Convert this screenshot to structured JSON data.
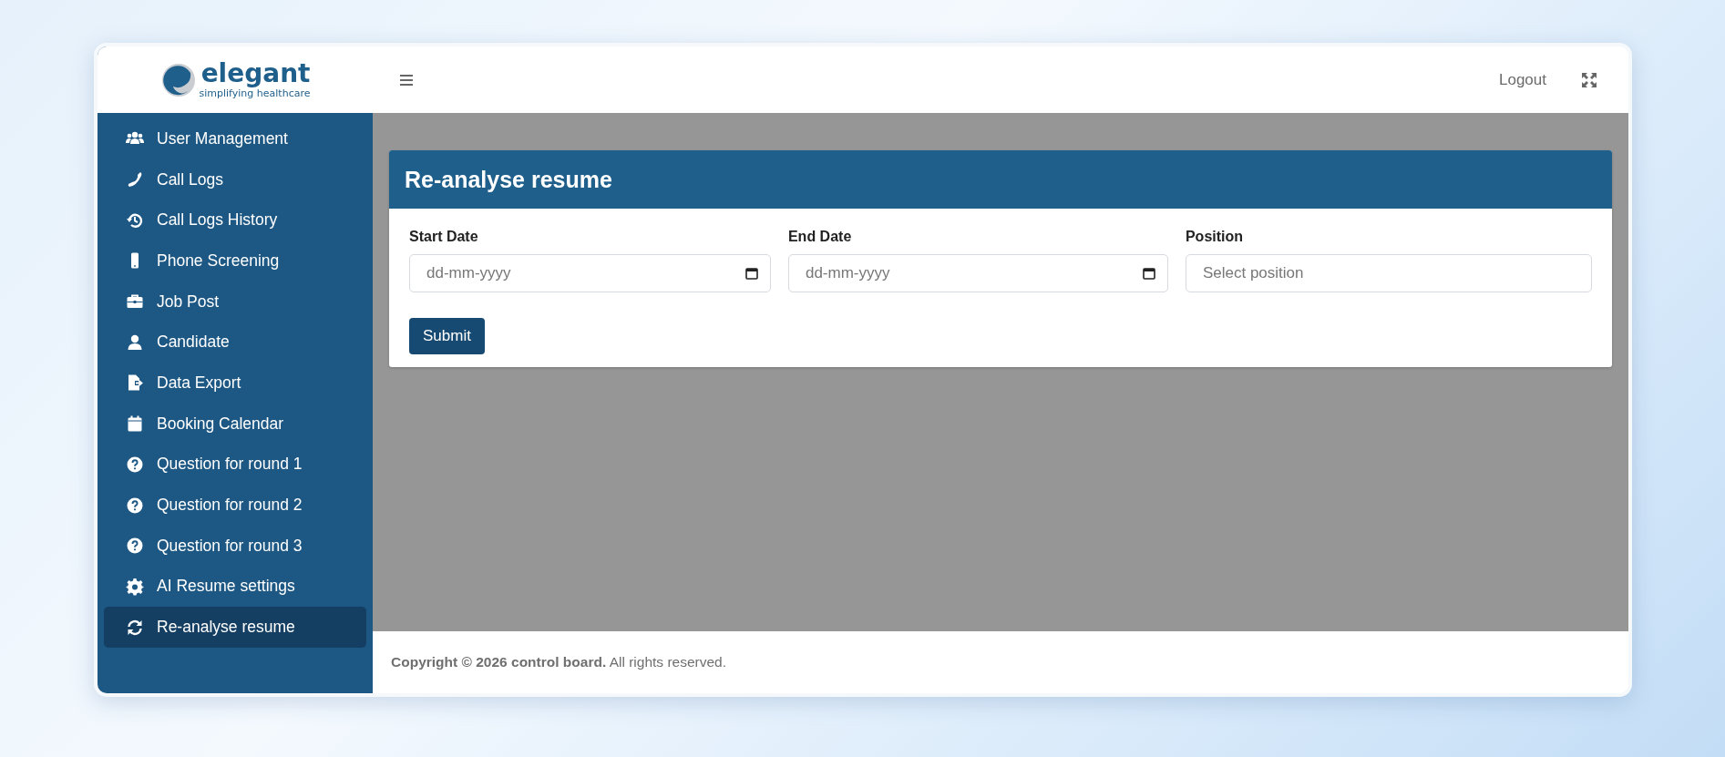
{
  "logo": {
    "name": "elegant",
    "tagline": "simplifying healthcare"
  },
  "sidebar": {
    "items": [
      {
        "label": "User Management",
        "selected": false
      },
      {
        "label": "Call Logs",
        "selected": false
      },
      {
        "label": "Call Logs History",
        "selected": false
      },
      {
        "label": "Phone Screening",
        "selected": false
      },
      {
        "label": "Job Post",
        "selected": false
      },
      {
        "label": "Candidate",
        "selected": false
      },
      {
        "label": "Data Export",
        "selected": false
      },
      {
        "label": "Booking Calendar",
        "selected": false
      },
      {
        "label": "Question for round 1",
        "selected": false
      },
      {
        "label": "Question for round 2",
        "selected": false
      },
      {
        "label": "Question for round 3",
        "selected": false
      },
      {
        "label": "AI Resume settings",
        "selected": false
      },
      {
        "label": "Re-analyse resume",
        "selected": true
      }
    ]
  },
  "header": {
    "logout": "Logout"
  },
  "card": {
    "title": "Re-analyse resume",
    "fields": [
      {
        "label": "Start Date",
        "kind": "date",
        "placeholder": "dd-mm-yyyy"
      },
      {
        "label": "End Date",
        "kind": "date",
        "placeholder": "dd-mm-yyyy"
      },
      {
        "label": "Position",
        "kind": "select",
        "placeholder": "Select position"
      }
    ],
    "submit": "Submit"
  },
  "footer": {
    "text": "**Copyright © 2026 control board.** All rights reserved."
  }
}
